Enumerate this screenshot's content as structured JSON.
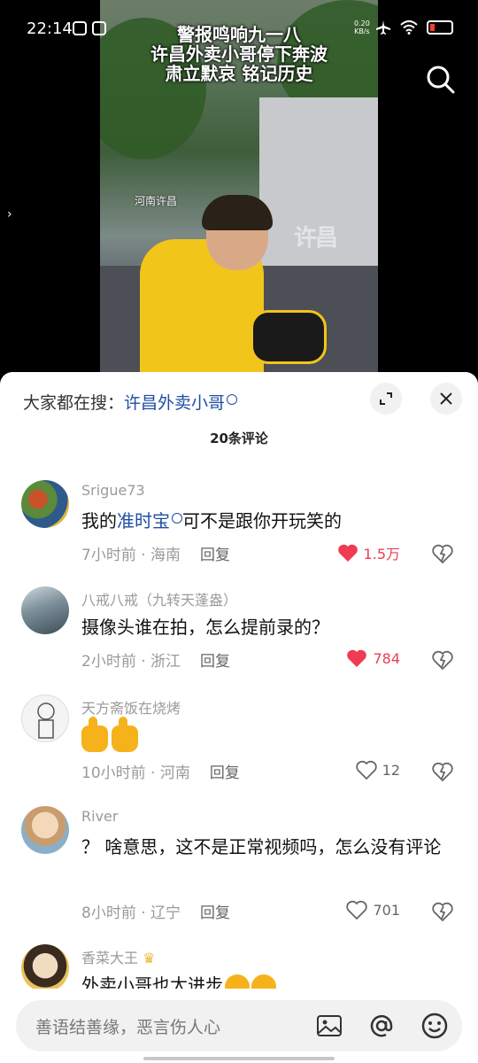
{
  "status_bar": {
    "time": "22:14",
    "net_speed": "0.20",
    "net_unit": "KB/s"
  },
  "video": {
    "caption_lines": [
      "警报鸣响九一八",
      "许昌外卖小哥停下奔波",
      "肃立默哀 铭记历史"
    ],
    "location_tag": "河南许昌",
    "watermark": "许昌"
  },
  "sheet": {
    "search_prefix": "大家都在搜：",
    "search_keyword": "许昌外卖小哥",
    "comment_count_title": "20条评论"
  },
  "comments": [
    {
      "name": "Srigue73",
      "text_before": "我的",
      "text_link": "准时宝",
      "text_after": "可不是跟你开玩笑的",
      "time": "7小时前 · 海南",
      "reply": "回复",
      "likes": "1.5万",
      "liked": true
    },
    {
      "name": "八戒八戒（九转天蓬盎）",
      "text": "摄像头谁在拍，怎么提前录的？",
      "time": "2小时前 · 浙江",
      "reply": "回复",
      "likes": "784",
      "liked": true
    },
    {
      "name": "天方斋饭在烧烤",
      "text": "",
      "time": "10小时前 · 河南",
      "reply": "回复",
      "likes": "12",
      "liked": false
    },
    {
      "name": "River",
      "text": "？ 啥意思，这不是正常视频吗，怎么没有评论",
      "time": "8小时前 · 辽宁",
      "reply": "回复",
      "likes": "701",
      "liked": false
    },
    {
      "name": "香菜大王",
      "text": "外卖小哥也太进步",
      "time": "",
      "reply": "",
      "likes": "",
      "liked": false
    }
  ],
  "input": {
    "placeholder": "善语结善缘，恶言伤人心"
  },
  "colors": {
    "like_red": "#ef3b53",
    "link_blue": "#1f4ea1",
    "courier_yellow": "#f2c51b"
  }
}
